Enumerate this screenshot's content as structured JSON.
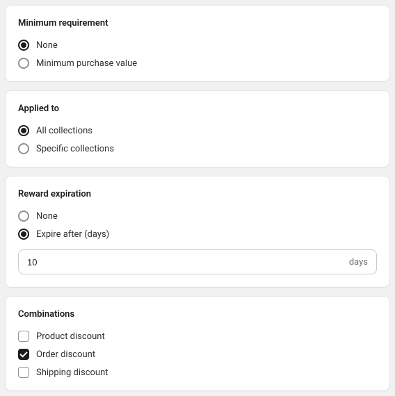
{
  "minimum_requirement": {
    "title": "Minimum requirement",
    "options": {
      "none": "None",
      "min_purchase": "Minimum purchase value"
    },
    "selected": "none"
  },
  "applied_to": {
    "title": "Applied to",
    "options": {
      "all": "All collections",
      "specific": "Specific collections"
    },
    "selected": "all"
  },
  "reward_expiration": {
    "title": "Reward expiration",
    "options": {
      "none": "None",
      "expire_after": "Expire after (days)"
    },
    "selected": "expire_after",
    "days_value": "10",
    "days_suffix": "days"
  },
  "combinations": {
    "title": "Combinations",
    "options": {
      "product": {
        "label": "Product discount",
        "checked": false
      },
      "order": {
        "label": "Order discount",
        "checked": true
      },
      "shipping": {
        "label": "Shipping discount",
        "checked": false
      }
    }
  }
}
